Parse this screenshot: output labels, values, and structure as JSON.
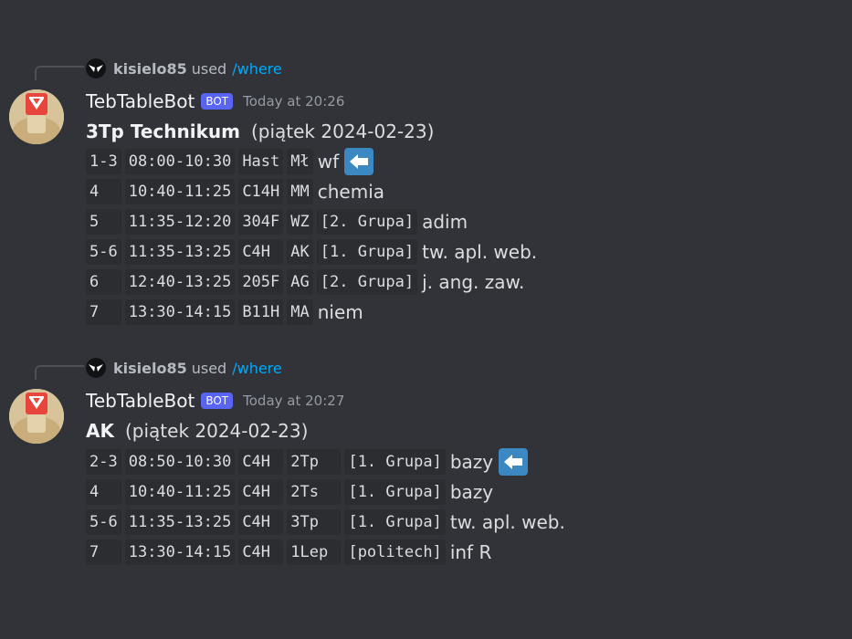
{
  "colors": {
    "background": "#313338",
    "command": "#00a8fc",
    "bot_tag": "#5865f2",
    "code_bg": "#2b2d31",
    "arrow": "#3b88c3"
  },
  "messages": [
    {
      "reply_user": "kisielo85",
      "reply_used": "used",
      "reply_command": "/where",
      "bot_name": "TebTableBot",
      "bot_tag": "BOT",
      "timestamp": "Today at 20:26",
      "title_bold": "3Tp Technikum",
      "title_date": "(piątek  2024-02-23)",
      "rows": [
        {
          "cells": [
            "1-3",
            "08:00-10:30",
            "Hast",
            "Mł"
          ],
          "subject": "wf",
          "current": true
        },
        {
          "cells": [
            "4  ",
            "10:40-11:25",
            "C14H",
            "MM"
          ],
          "subject": "chemia",
          "current": false
        },
        {
          "cells": [
            "5  ",
            "11:35-12:20",
            "304F",
            "WZ",
            "[2. Grupa]"
          ],
          "subject": "adim",
          "current": false
        },
        {
          "cells": [
            "5-6",
            "11:35-13:25",
            "C4H ",
            "AK",
            "[1. Grupa]"
          ],
          "subject": "tw. apl. web.",
          "current": false
        },
        {
          "cells": [
            "6  ",
            "12:40-13:25",
            "205F",
            "AG",
            "[2. Grupa]"
          ],
          "subject": "j. ang. zaw.",
          "current": false
        },
        {
          "cells": [
            "7  ",
            "13:30-14:15",
            "B11H",
            "MA"
          ],
          "subject": "niem",
          "current": false
        }
      ]
    },
    {
      "reply_user": "kisielo85",
      "reply_used": "used",
      "reply_command": "/where",
      "bot_name": "TebTableBot",
      "bot_tag": "BOT",
      "timestamp": "Today at 20:27",
      "title_bold": "AK",
      "title_date": "(piątek  2024-02-23)",
      "rows": [
        {
          "cells": [
            "2-3",
            "08:50-10:30",
            "C4H ",
            "2Tp  ",
            "[1. Grupa]"
          ],
          "subject": "bazy",
          "current": true
        },
        {
          "cells": [
            "4  ",
            "10:40-11:25",
            "C4H ",
            "2Ts  ",
            "[1. Grupa]"
          ],
          "subject": "bazy",
          "current": false
        },
        {
          "cells": [
            "5-6",
            "11:35-13:25",
            "C4H ",
            "3Tp  ",
            "[1. Grupa]"
          ],
          "subject": "tw. apl. web.",
          "current": false
        },
        {
          "cells": [
            "7  ",
            "13:30-14:15",
            "C4H ",
            "1Lep ",
            "[politech]"
          ],
          "subject": "inf R",
          "current": false
        }
      ]
    }
  ]
}
